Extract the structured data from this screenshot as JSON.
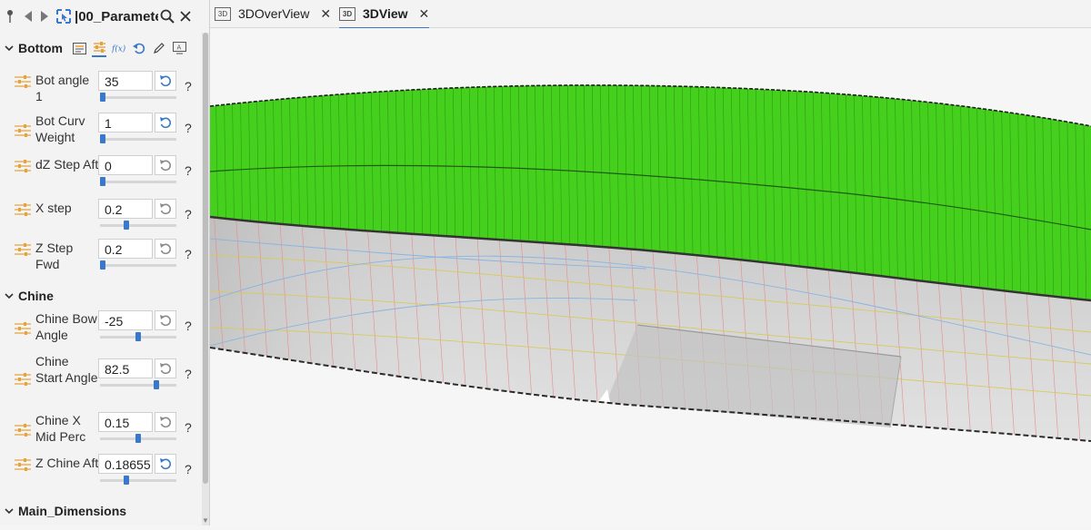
{
  "panel": {
    "title": "|00_Paramete",
    "section_bottom": "Bottom",
    "section_chine": "Chine",
    "section_main": "Main_Dimensions"
  },
  "bottom_params": [
    {
      "label": "Bot angle 1",
      "value": "35",
      "slider": 0.0,
      "reset_active": true
    },
    {
      "label": "Bot Curv Weight",
      "value": "1",
      "slider": 0.0,
      "reset_active": true
    },
    {
      "label": "dZ Step Aft",
      "value": "0",
      "slider": 0.0,
      "reset_active": false
    },
    {
      "label": "X step",
      "value": "0.2",
      "slider": 0.33,
      "reset_active": false
    },
    {
      "label": "Z Step Fwd",
      "value": "0.2",
      "slider": 0.0,
      "reset_active": false
    }
  ],
  "chine_params": [
    {
      "label": "Chine Bow Angle",
      "value": "-25",
      "slider": 0.5,
      "reset_active": false
    },
    {
      "label": "Chine Start Angle",
      "value": "82.5",
      "slider": 0.75,
      "reset_active": false
    },
    {
      "label": "Chine X Mid Perc",
      "value": "0.15",
      "slider": 0.5,
      "reset_active": false
    },
    {
      "label": "Z Chine Aft",
      "value": "0.18655",
      "slider": 0.33,
      "reset_active": true
    }
  ],
  "help_text": "?",
  "tabs": [
    {
      "badge": "3D",
      "label": "3DOverView",
      "active": false
    },
    {
      "badge": "3D",
      "label": "3DView",
      "active": true
    }
  ],
  "colors": {
    "accent": "#3a78c9",
    "hull_side": "#46d01e",
    "icon_orange": "#e8a23a"
  }
}
